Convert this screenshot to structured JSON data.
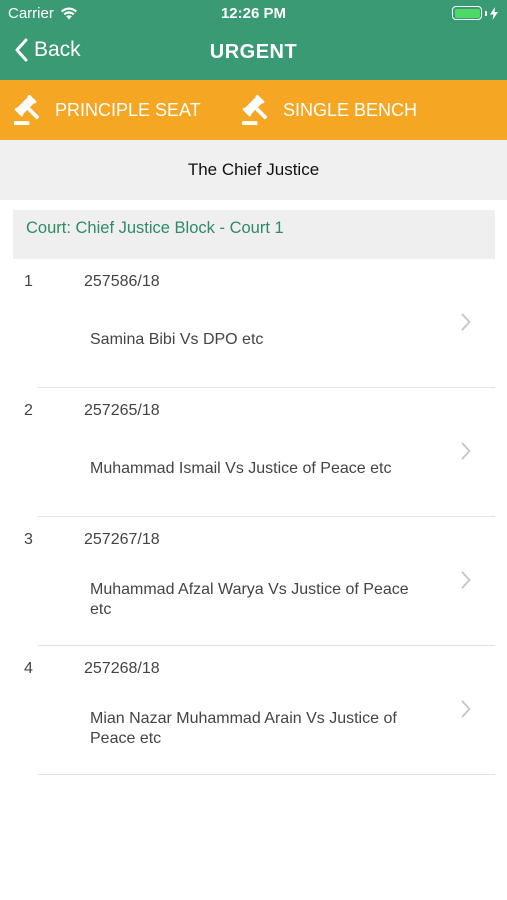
{
  "status_bar": {
    "carrier": "Carrier",
    "time": "12:26 PM"
  },
  "nav": {
    "back_label": "Back",
    "title": "URGENT"
  },
  "tabs": [
    {
      "label": "PRINCIPLE SEAT",
      "icon": "gavel-icon"
    },
    {
      "label": "SINGLE BENCH",
      "icon": "gavel-icon"
    }
  ],
  "bench": {
    "title": "The Chief Justice"
  },
  "court": {
    "label": "Court: Chief Justice Block - Court 1"
  },
  "cases": [
    {
      "index": "1",
      "number": "257586/18",
      "title": "Samina Bibi Vs DPO etc"
    },
    {
      "index": "2",
      "number": "257265/18",
      "title": "Muhammad Ismail Vs Justice of Peace etc"
    },
    {
      "index": "3",
      "number": "257267/18",
      "title": "Muhammad Afzal Warya Vs Justice of Peace etc"
    },
    {
      "index": "4",
      "number": "257268/18",
      "title": "Mian Nazar Muhammad Arain Vs Justice of Peace etc"
    }
  ],
  "colors": {
    "header": "#3a9a73",
    "tab_bar": "#f5a623",
    "court_text": "#2e8b63"
  }
}
